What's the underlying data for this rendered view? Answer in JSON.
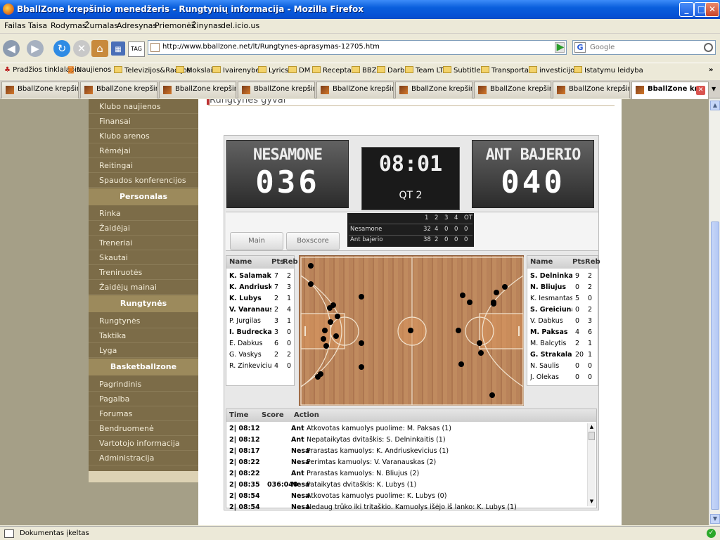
{
  "window": {
    "title": "BballZone krepšinio menedžeris - Rungtynių informacija - Mozilla Firefox"
  },
  "menubar": [
    "Failas",
    "Taisa",
    "Rodymas",
    "Žurnalas",
    "Adresynas",
    "Priemonės",
    "Žinynas",
    "del.icio.us"
  ],
  "navbar": {
    "url": "http://www.bballzone.net/lt/Rungtynes-aprasymas-12705.htm",
    "search_placeholder": "Google",
    "search_engine": "G",
    "tag_label": "TAG"
  },
  "bookmarks": [
    "Pradžios tinklalapis",
    "Naujienos",
    "Televizijos&Radijos",
    "Mokslai",
    "Ivairenybes",
    "Lyrics",
    "DM",
    "Receptai",
    "BBZ",
    "Darb",
    "Team LT",
    "Subtitles",
    "Transportas",
    "investicijos",
    "Istatymu leidyba"
  ],
  "bookmarks_more": "»",
  "tabs": [
    {
      "label": "BballZone krepšini...",
      "active": false
    },
    {
      "label": "BballZone krepšini...",
      "active": false
    },
    {
      "label": "BballZone krepšini...",
      "active": false
    },
    {
      "label": "BballZone krepšini...",
      "active": false
    },
    {
      "label": "BballZone krepšini...",
      "active": false
    },
    {
      "label": "BballZone krepšini...",
      "active": false
    },
    {
      "label": "BballZone krepšini...",
      "active": false
    },
    {
      "label": "BballZone krepšini...",
      "active": false
    },
    {
      "label": "BballZone kr...",
      "active": true
    }
  ],
  "sidebar": {
    "items_top": [
      "Klubo naujienos",
      "Finansai",
      "Klubo arenos",
      "Rėmėjai",
      "Reitingai",
      "Spaudos konferencijos"
    ],
    "head_personalas": "Personalas",
    "items_personalas": [
      "Rinka",
      "Žaidėjai",
      "Treneriai",
      "Skautai",
      "Treniruotės",
      "Žaidėjų mainai"
    ],
    "head_rungtynes": "Rungtynės",
    "items_rungtynes": [
      "Rungtynės",
      "Taktika",
      "Lyga"
    ],
    "head_bbz": "Basketballzone",
    "items_bbz": [
      "Pagrindinis",
      "Pagalba",
      "Forumas",
      "Bendruomenė",
      "Vartotojo informacija",
      "Administracija"
    ]
  },
  "content": {
    "heading": "Rungtynės gyvai"
  },
  "scoreboard": {
    "home_name": "NESAMONE",
    "home_score": "036",
    "away_name": "ANT BAJERIO",
    "away_score": "040",
    "clock": "08:01",
    "quarter": "QT 2",
    "btn_main": "Main",
    "btn_boxscore": "Boxscore"
  },
  "quarters": {
    "headers": [
      "1",
      "2",
      "3",
      "4",
      "OT"
    ],
    "rows": [
      {
        "team": "Nesamone",
        "vals": [
          "32",
          "4",
          "0",
          "0",
          "0"
        ]
      },
      {
        "team": "Ant bajerio",
        "vals": [
          "38",
          "2",
          "0",
          "0",
          "0"
        ]
      }
    ]
  },
  "box_headers": {
    "name": "Name",
    "pts": "Pts",
    "reb": "Reb"
  },
  "home_players": [
    {
      "name": "K. Salamakin",
      "pts": "7",
      "reb": "2",
      "bold": true
    },
    {
      "name": "K. Andriuske",
      "pts": "7",
      "reb": "3",
      "bold": true
    },
    {
      "name": "K. Lubys",
      "pts": "2",
      "reb": "1",
      "bold": true
    },
    {
      "name": "V. Varanausk",
      "pts": "2",
      "reb": "4",
      "bold": true
    },
    {
      "name": "P. Jurgilas",
      "pts": "3",
      "reb": "1",
      "bold": false
    },
    {
      "name": "I. Budreckas",
      "pts": "3",
      "reb": "0",
      "bold": true
    },
    {
      "name": "E. Dabkus",
      "pts": "6",
      "reb": "0",
      "bold": false
    },
    {
      "name": "G. Vaskys",
      "pts": "2",
      "reb": "2",
      "bold": false
    },
    {
      "name": "R. Zinkevicius",
      "pts": "4",
      "reb": "0",
      "bold": false
    }
  ],
  "away_players": [
    {
      "name": "S. Delninkaiti",
      "pts": "9",
      "reb": "2",
      "bold": true
    },
    {
      "name": "N. Bliujus",
      "pts": "0",
      "reb": "2",
      "bold": true
    },
    {
      "name": "K. Iesmantas",
      "pts": "5",
      "reb": "0",
      "bold": false
    },
    {
      "name": "S. Greiciunas",
      "pts": "0",
      "reb": "2",
      "bold": true
    },
    {
      "name": "V. Dabkus",
      "pts": "0",
      "reb": "3",
      "bold": false
    },
    {
      "name": "M. Paksas",
      "pts": "4",
      "reb": "6",
      "bold": true
    },
    {
      "name": "M. Balcytis",
      "pts": "2",
      "reb": "1",
      "bold": false
    },
    {
      "name": "G. Strakalas",
      "pts": "20",
      "reb": "1",
      "bold": true
    },
    {
      "name": "N. Saulis",
      "pts": "0",
      "reb": "0",
      "bold": false
    },
    {
      "name": "J. Olekas",
      "pts": "0",
      "reb": "0",
      "bold": false
    }
  ],
  "pbp_headers": {
    "time": "Time",
    "score": "Score",
    "action": "Action"
  },
  "pbp": [
    {
      "time": "2| 08:12",
      "score": "",
      "team": "Ant",
      "text": "Atkovotas kamuolys puolime: M. Paksas (1)"
    },
    {
      "time": "2| 08:12",
      "score": "",
      "team": "Ant",
      "text": "Nepataikytas dvitaškis: S. Delninkaitis (1)"
    },
    {
      "time": "2| 08:17",
      "score": "",
      "team": "Nesa",
      "text": "Prarastas kamuolys: K. Andriuskevicius (1)"
    },
    {
      "time": "2| 08:22",
      "score": "",
      "team": "Nesa",
      "text": "Perimtas kamuolys: V. Varanauskas (2)"
    },
    {
      "time": "2| 08:22",
      "score": "",
      "team": "Ant",
      "text": "Prarastas kamuolys: N. Bliujus (2)"
    },
    {
      "time": "2| 08:35",
      "score": "036:040",
      "team": "Nesa",
      "text": "Pataikytas dvitaškis: K. Lubys (1)"
    },
    {
      "time": "2| 08:54",
      "score": "",
      "team": "Nesa",
      "text": "Atkovotas kamuolys puolime: K. Lubys (0)"
    },
    {
      "time": "2| 08:54",
      "score": "",
      "team": "Nesa",
      "text": "Nedaug trūko iki tritaškio. Kamuolys išėjo iš lanko: K. Lubys (1)"
    }
  ],
  "status": {
    "text": "Dokumentas įkeltas"
  }
}
